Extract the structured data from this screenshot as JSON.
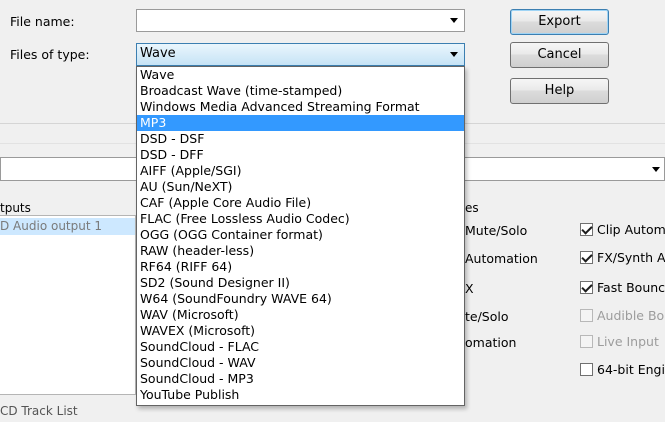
{
  "file_name": {
    "label": "File name:",
    "value": ""
  },
  "files_of_type": {
    "label": "Files of type:",
    "selected": "Wave"
  },
  "buttons": {
    "export": "Export",
    "cancel": "Cancel",
    "help": "Help"
  },
  "dropdown": {
    "selected_index": 3,
    "options": [
      "Wave",
      "Broadcast Wave (time-stamped)",
      "Windows Media  Advanced Streaming Format",
      "MP3",
      "DSD - DSF",
      "DSD - DFF",
      "AIFF (Apple/SGI)",
      "AU (Sun/NeXT)",
      "CAF (Apple Core Audio File)",
      "FLAC (Free Lossless Audio Codec)",
      "OGG (OGG Container format)",
      "RAW (header-less)",
      "RF64 (RIFF 64)",
      "SD2 (Sound Designer II)",
      "W64 (SoundFoundry WAVE 64)",
      "WAV (Microsoft)",
      "WAVEX (Microsoft)",
      "SoundCloud - FLAC",
      "SoundCloud - WAV",
      "SoundCloud - MP3",
      "YouTube Publish"
    ]
  },
  "background": {
    "outputs_header": "tputs",
    "output_item": "D Audio output 1",
    "options_header": "es",
    "mid_options": [
      "Mute/Solo",
      "Automation",
      "X",
      "te/Solo",
      "omation"
    ],
    "right_options": [
      {
        "label": "Clip Automa",
        "checked": true,
        "enabled": true
      },
      {
        "label": "FX/Synth Au",
        "checked": true,
        "enabled": true
      },
      {
        "label": "Fast Bounc",
        "checked": true,
        "enabled": true
      },
      {
        "label": "Audible Bou",
        "checked": false,
        "enabled": false
      },
      {
        "label": "Live Input",
        "checked": false,
        "enabled": false
      },
      {
        "label": "64-bit Engin",
        "checked": false,
        "enabled": true
      }
    ],
    "cd_track_list": "CD Track List"
  },
  "colors": {
    "selection": "#3399ff",
    "accent_border": "#3c7fb1"
  }
}
